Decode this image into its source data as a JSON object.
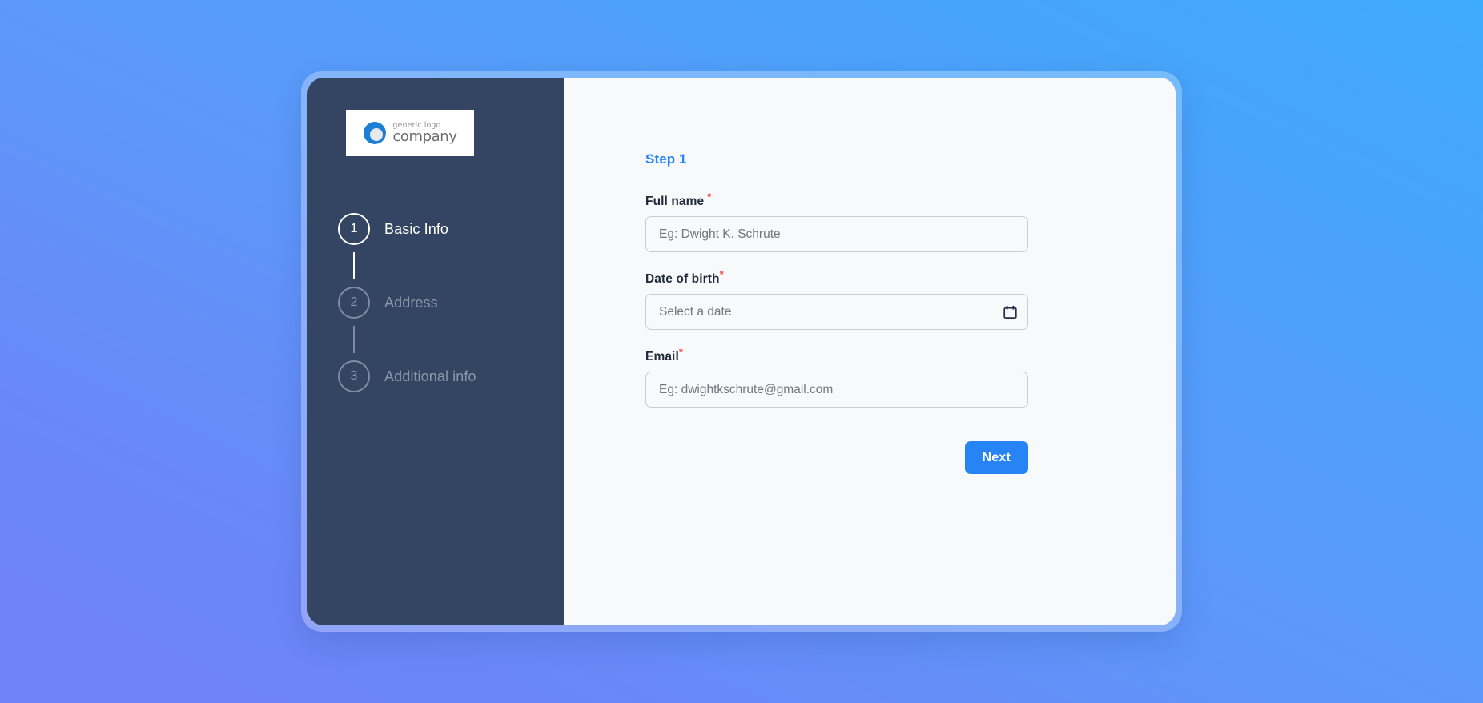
{
  "brand": {
    "logo_top_text": "generic logo",
    "logo_bottom_text": "company",
    "logo_icon": "circle-ring-logo-icon"
  },
  "colors": {
    "accent_blue": "#2684f5",
    "sidebar_bg": "#344563",
    "panel_bg": "#f8f9fa",
    "required_red": "#f2413b",
    "muted_step": "#8b97a8"
  },
  "sidebar": {
    "steps": [
      {
        "number": "1",
        "label": "Basic Info",
        "active": true
      },
      {
        "number": "2",
        "label": "Address",
        "active": false
      },
      {
        "number": "3",
        "label": "Additional info",
        "active": false
      }
    ]
  },
  "main": {
    "step_indicator": "Step 1",
    "fields": [
      {
        "label": "Full name",
        "required_marker": "*",
        "value": "",
        "placeholder": "Eg: Dwight K. Schrute",
        "type": "text"
      },
      {
        "label": "Date of birth",
        "required_marker": "*",
        "value": "",
        "placeholder": "Select a date",
        "type": "date",
        "icon": "calendar-icon"
      },
      {
        "label": "Email",
        "required_marker": "*",
        "value": "",
        "placeholder": "Eg: dwightkschrute@gmail.com",
        "type": "email"
      }
    ],
    "next_button_label": "Next"
  }
}
